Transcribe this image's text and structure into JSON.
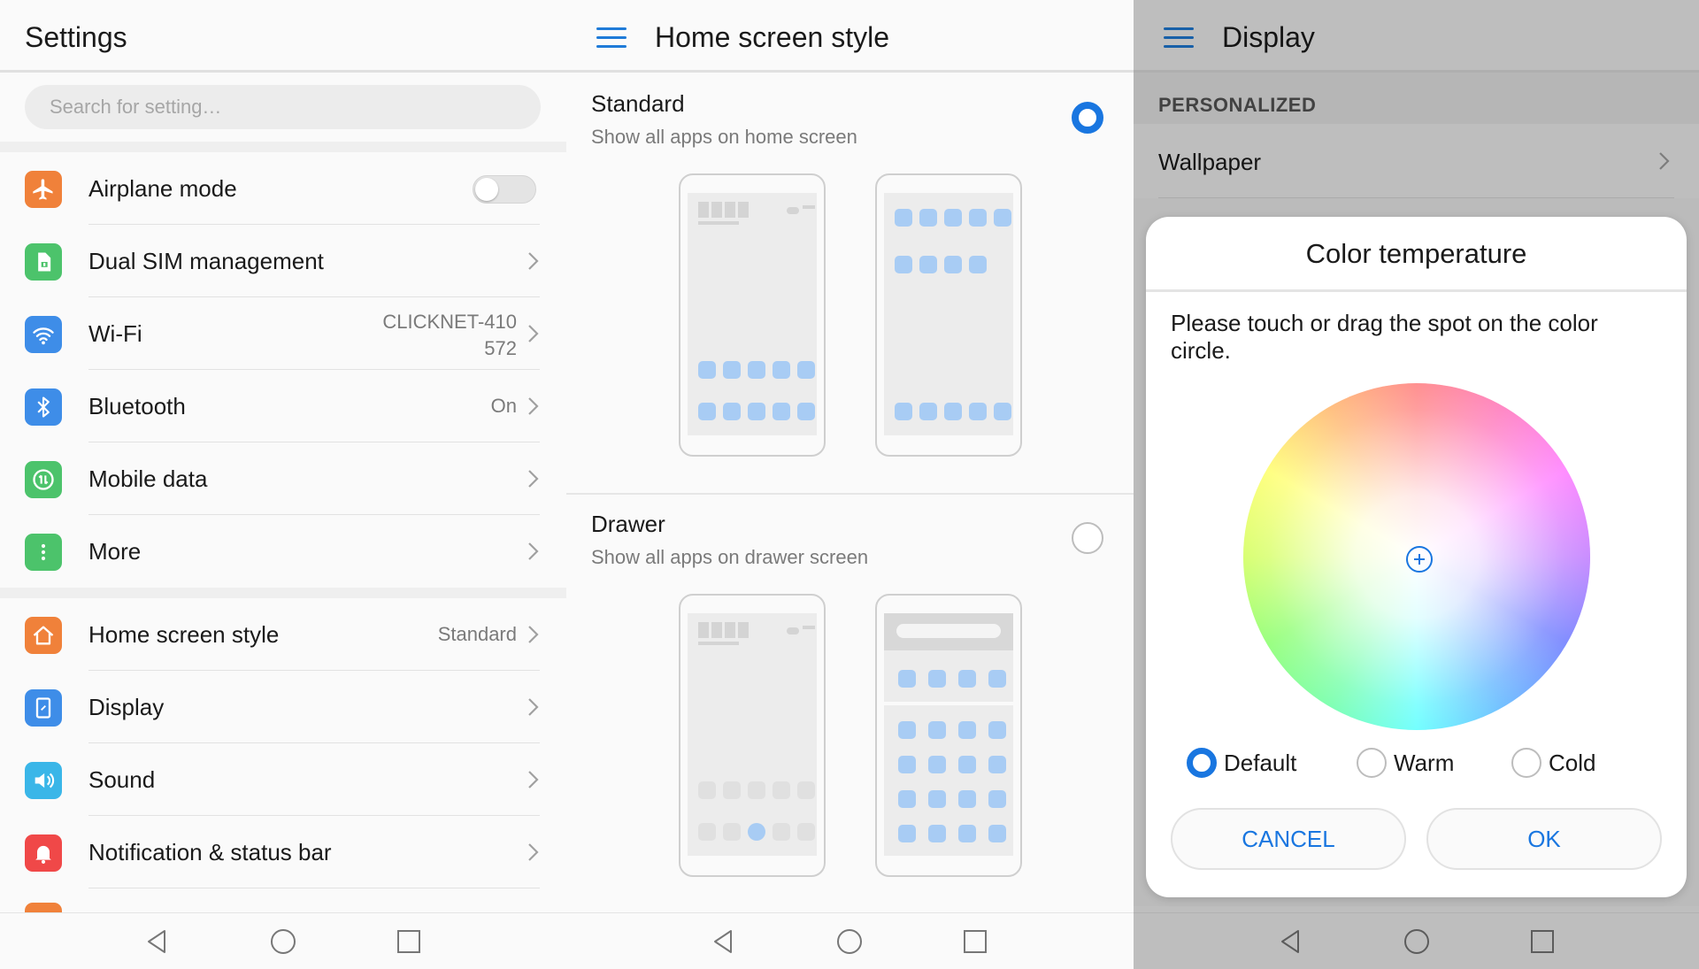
{
  "settings": {
    "title": "Settings",
    "search_placeholder": "Search for setting…",
    "items": [
      {
        "label": "Airplane mode",
        "icon": "airplane-icon",
        "color": "#f0813a"
      },
      {
        "label": "Dual SIM management",
        "icon": "sim-card-icon",
        "color": "#4cc36b"
      },
      {
        "label": "Wi-Fi",
        "icon": "wifi-icon",
        "color": "#3e8de8",
        "value_line1": "CLICKNET-410",
        "value_line2": "572"
      },
      {
        "label": "Bluetooth",
        "icon": "bluetooth-icon",
        "color": "#3e8de8",
        "value": "On"
      },
      {
        "label": "Mobile data",
        "icon": "mobile-data-icon",
        "color": "#4cc36b"
      },
      {
        "label": "More",
        "icon": "more-icon",
        "color": "#4cc36b"
      },
      {
        "label": "Home screen style",
        "icon": "home-icon",
        "color": "#f0813a",
        "value": "Standard"
      },
      {
        "label": "Display",
        "icon": "display-icon",
        "color": "#3e8de8"
      },
      {
        "label": "Sound",
        "icon": "sound-icon",
        "color": "#3ab6e8"
      },
      {
        "label": "Notification & status bar",
        "icon": "bell-icon",
        "color": "#f04848"
      }
    ]
  },
  "home_style": {
    "title": "Home screen style",
    "options": [
      {
        "title": "Standard",
        "subtitle": "Show all apps on home screen",
        "selected": true
      },
      {
        "title": "Drawer",
        "subtitle": "Show all apps on drawer screen",
        "selected": false
      }
    ]
  },
  "display": {
    "title": "Display",
    "section": "PERSONALIZED",
    "wallpaper": "Wallpaper",
    "dialog": {
      "title": "Color temperature",
      "text": "Please touch or drag the spot on the color circle.",
      "options": [
        {
          "label": "Default",
          "selected": true
        },
        {
          "label": "Warm",
          "selected": false
        },
        {
          "label": "Cold",
          "selected": false
        }
      ],
      "cancel": "CANCEL",
      "ok": "OK"
    }
  },
  "colors": {
    "accent": "#1976e0",
    "icon_blue": "#a8ccf4"
  }
}
